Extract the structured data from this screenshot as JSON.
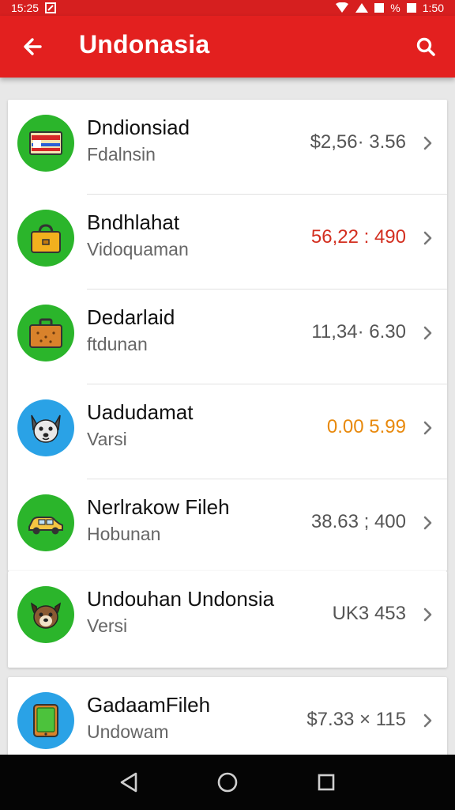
{
  "status_bar": {
    "time_left": "15:25",
    "time_right": "1:50",
    "battery_text": "%"
  },
  "app_bar": {
    "title": "Undonasia",
    "back_icon": "arrow-left-icon",
    "search_icon": "search-icon"
  },
  "items": [
    {
      "name": "Dndionsiad",
      "sub": "Fdalnsin",
      "amount": "$2,56· 3.56",
      "amount_color": "#555555",
      "icon": "flag-icon"
    },
    {
      "name": "Bndhlahat",
      "sub": "Vidoquaman",
      "amount": "56,22 : 490",
      "amount_color": "#d32f20",
      "icon": "handbag-icon"
    },
    {
      "name": "Dedarlaid",
      "sub": "ftdunan",
      "amount": "11,34· 6.30",
      "amount_color": "#555555",
      "icon": "suitcase-icon"
    },
    {
      "name": "Uadudamat",
      "sub": "Varsi",
      "amount": "0.00 5.99",
      "amount_color": "#e8890c",
      "icon": "dog-icon"
    },
    {
      "name": "Nerlrakow Fileh",
      "sub": "Hobunan",
      "amount": "38.63 ; 400",
      "amount_color": "#555555",
      "icon": "car-icon"
    },
    {
      "name": "Undouhan Undonsia",
      "sub": "Versi",
      "amount": "UK3 453",
      "amount_color": "#555555",
      "icon": "dog-icon"
    },
    {
      "name": "GadaamFileh",
      "sub": "Undowam",
      "amount": "$7.33 × 115",
      "amount_color": "#555555",
      "icon": "tablet-icon"
    }
  ],
  "nav": {
    "back": "nav-back-icon",
    "home": "nav-home-icon",
    "recents": "nav-recents-icon"
  }
}
